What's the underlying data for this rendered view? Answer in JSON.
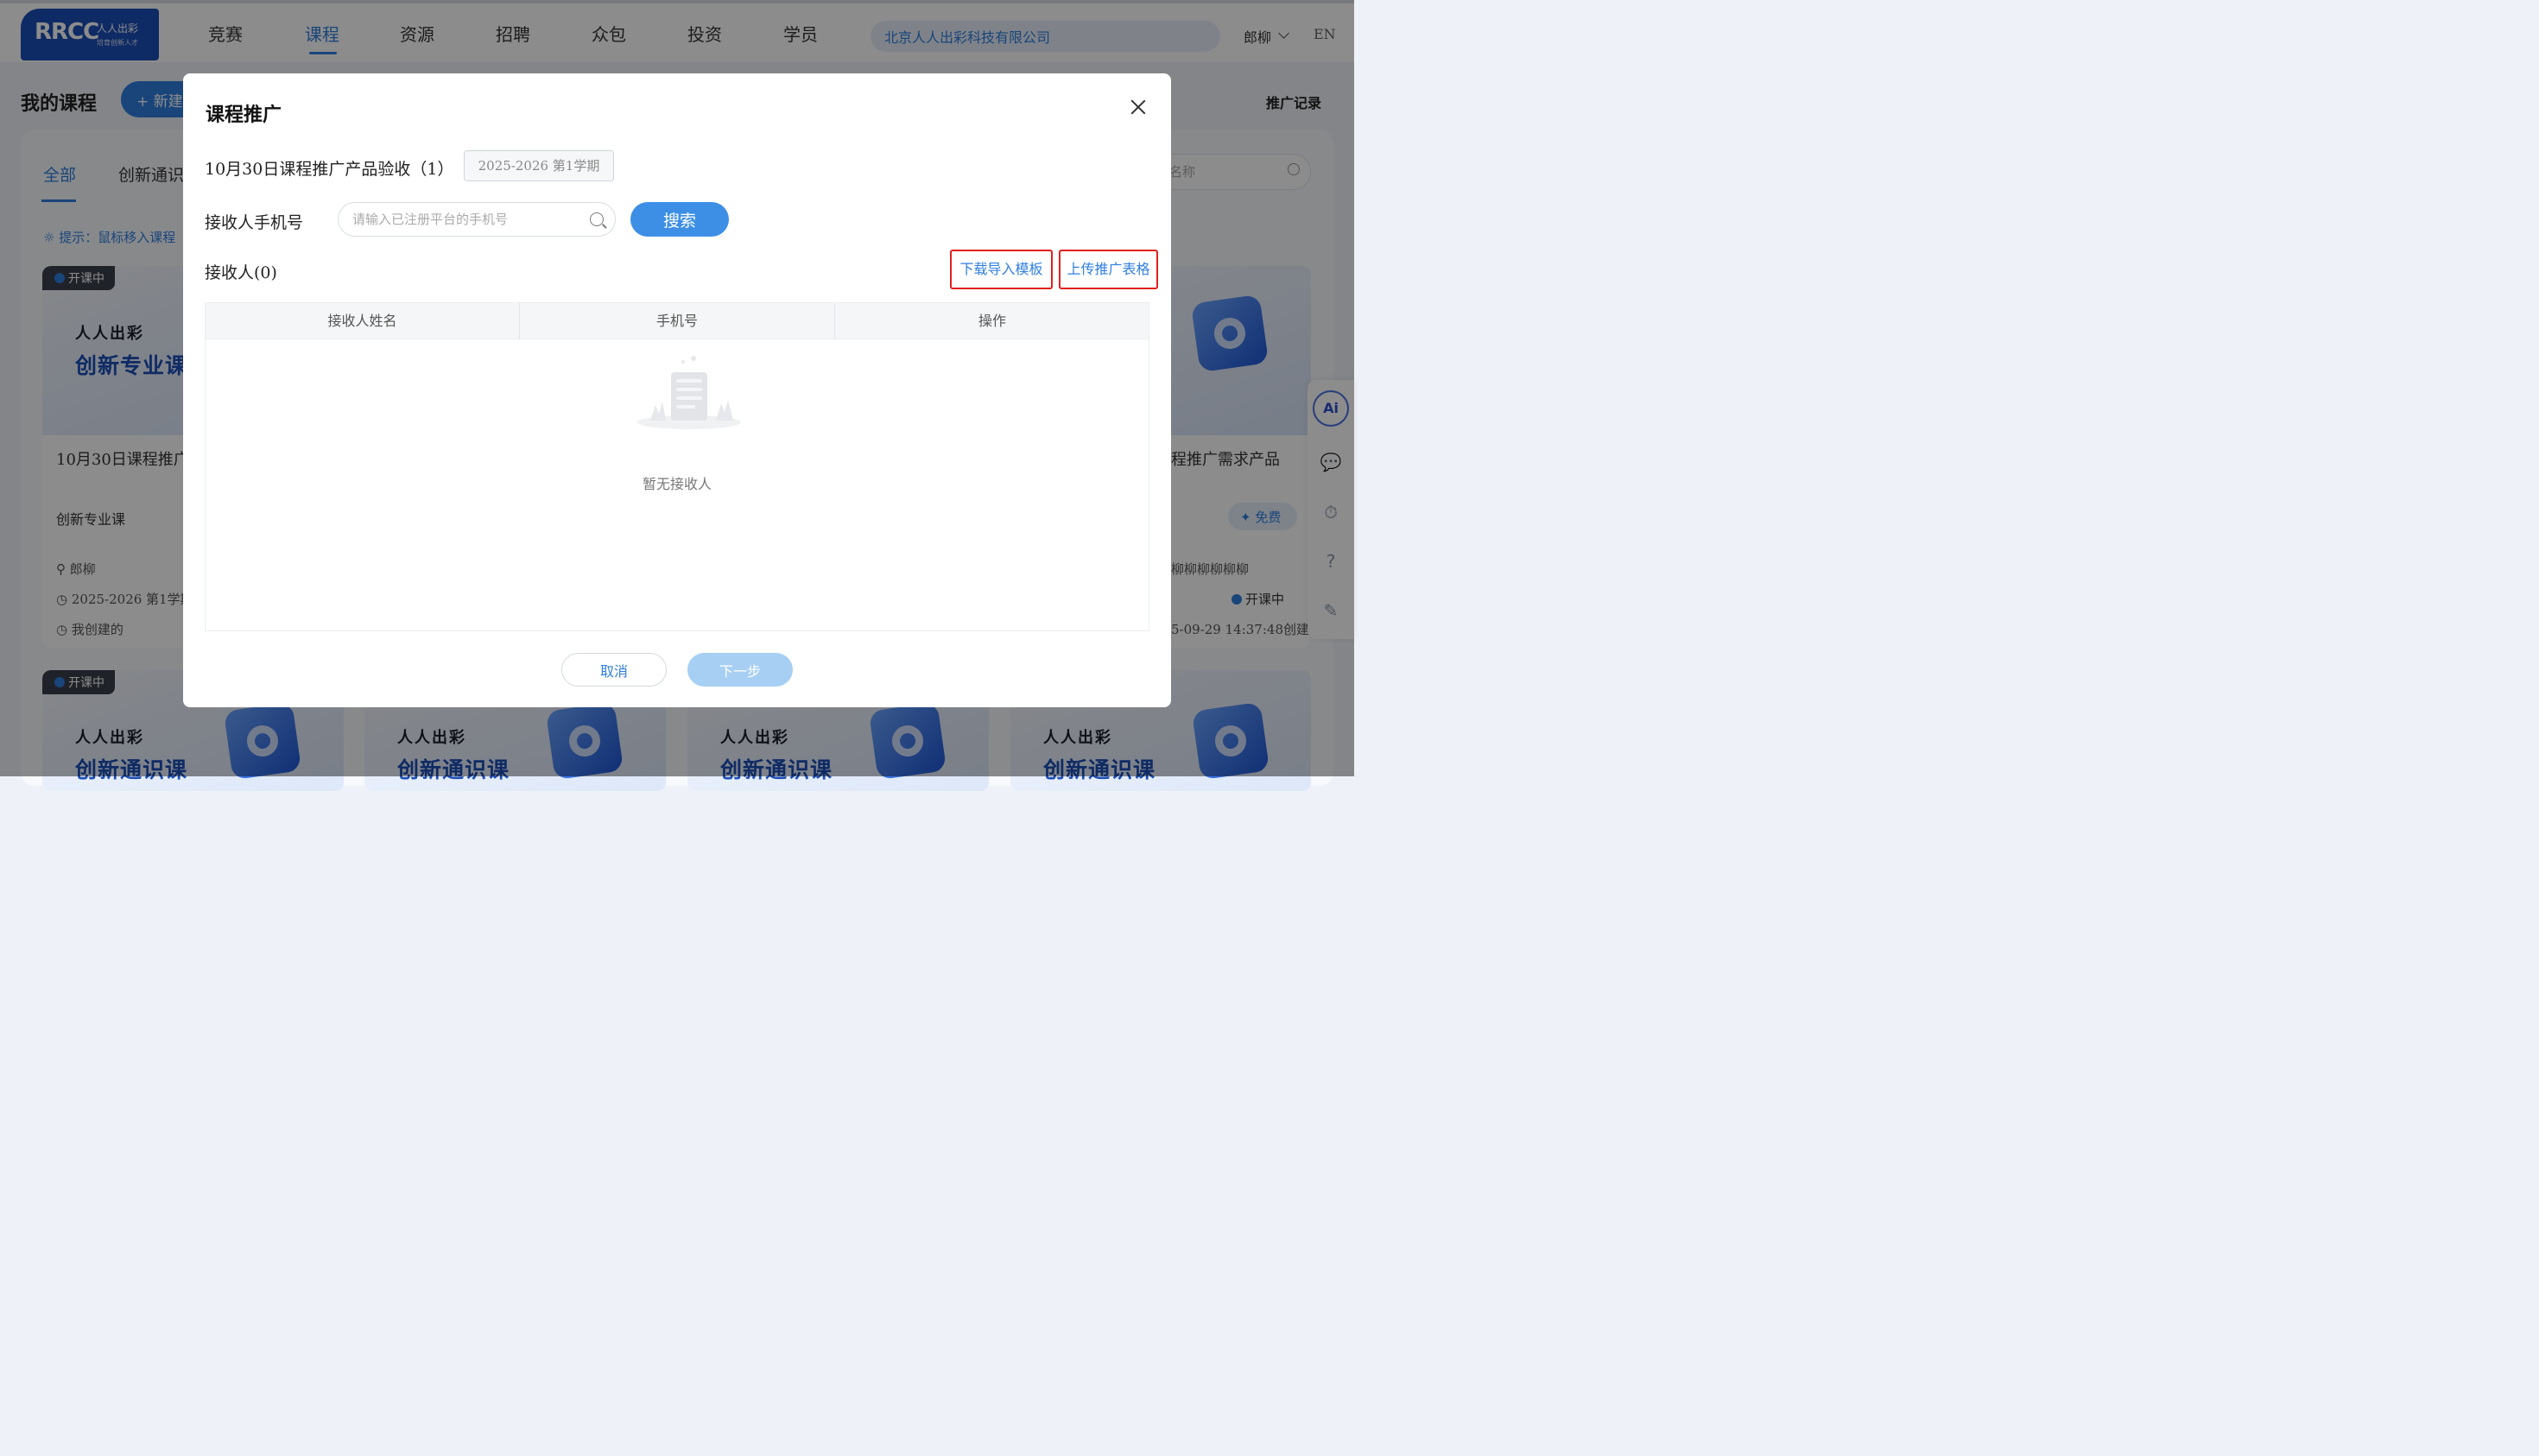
{
  "header": {
    "logo_text": "RRCC",
    "logo_sub1": "人人出彩",
    "logo_sub2": "培育创新人才",
    "nav": [
      "竞赛",
      "课程",
      "资源",
      "招聘",
      "众包",
      "投资",
      "学员"
    ],
    "active_nav": "课程",
    "company": "北京人人出彩科技有限公司",
    "user": "郎柳",
    "lang": "EN"
  },
  "page": {
    "title": "我的课程",
    "new_button": "+ 新建",
    "promo_record": "推广记录",
    "tabs": [
      "全部",
      "创新通识"
    ],
    "hint": "提示：鼠标移入课程",
    "search_placeholder": "名称"
  },
  "cards": {
    "badge": "开课中",
    "brand_small": "人人出彩",
    "brand_big_pro": "创新专业课",
    "brand_big_general": "创新通识课",
    "left_title": "10月30日课程推广",
    "left_category": "创新专业课",
    "left_teacher": "郎柳",
    "left_term": "2025-2026 第1学期",
    "left_owner": "我创建的",
    "right_title": "程推广需求产品",
    "right_free": "免费",
    "right_teacher": "柳柳柳柳柳柳",
    "right_status": "开课中",
    "right_created": "5-09-29 14:37:48创建"
  },
  "sidebar": {
    "ai": "Ai"
  },
  "modal": {
    "title": "课程推广",
    "course": "10月30日课程推广产品验收（1）",
    "term": "2025-2026 第1学期",
    "phone_label": "接收人手机号",
    "phone_placeholder": "请输入已注册平台的手机号",
    "phone_value": "",
    "search_button": "搜索",
    "receivers_label": "接收人(0)",
    "download_template": "下载导入模板",
    "upload_table": "上传推广表格",
    "columns": [
      "接收人姓名",
      "手机号",
      "操作"
    ],
    "empty_text": "暂无接收人",
    "cancel": "取消",
    "next": "下一步"
  }
}
